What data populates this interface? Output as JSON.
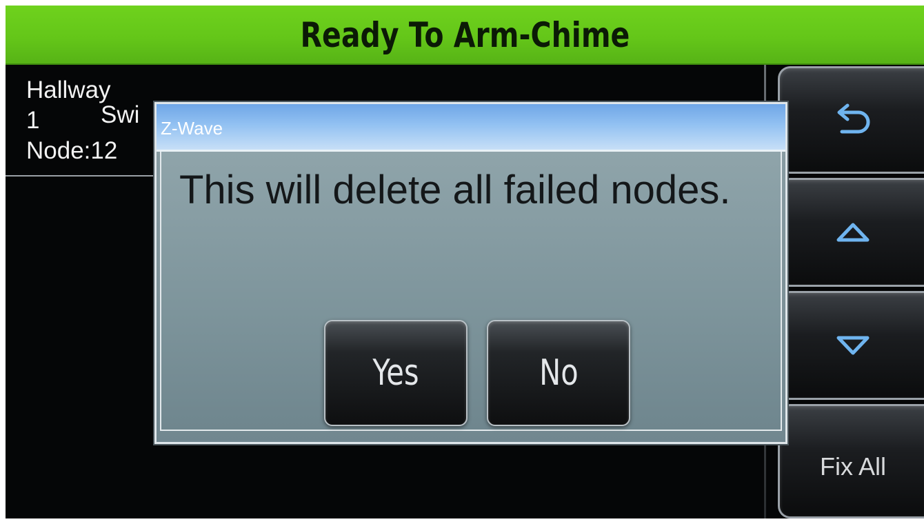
{
  "status_bar": {
    "title": "Ready To Arm-Chime",
    "color": "#64c619"
  },
  "device_list": {
    "items": [
      {
        "name": "Hallway",
        "number": "1",
        "type": "Swi",
        "node": "Node:12"
      }
    ]
  },
  "side_buttons": {
    "back_icon": "back-arrow-icon",
    "up_icon": "triangle-up-icon",
    "down_icon": "triangle-down-icon",
    "fix_all_label": "Fix All"
  },
  "dialog": {
    "title": "Z-Wave",
    "message": "This will delete all failed nodes.",
    "yes_label": "Yes",
    "no_label": "No",
    "header_color": "#92c1f2"
  }
}
